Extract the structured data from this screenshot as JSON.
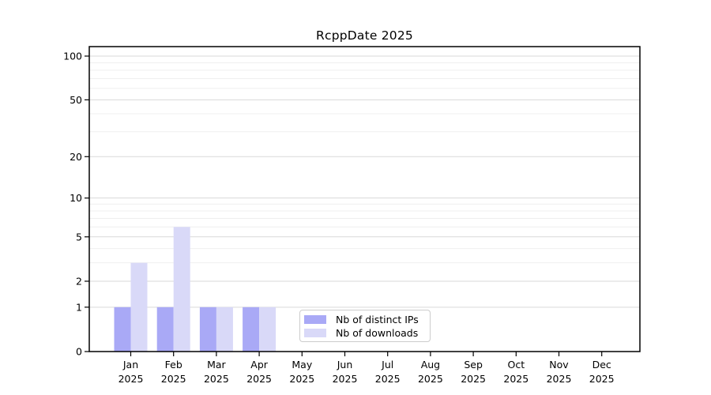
{
  "title": "RcppDate 2025",
  "chart_data": {
    "type": "bar",
    "title": "RcppDate 2025",
    "yscale": "log1p",
    "ylim": [
      0,
      100
    ],
    "y_major_ticks": [
      0,
      1,
      2,
      5,
      10,
      20,
      50,
      100
    ],
    "y_minor_gridlines": [
      3,
      4,
      6,
      7,
      8,
      9,
      30,
      40,
      60,
      70,
      80,
      90
    ],
    "grid": "horizontal",
    "months": [
      "Jan",
      "Feb",
      "Mar",
      "Apr",
      "May",
      "Jun",
      "Jul",
      "Aug",
      "Sep",
      "Oct",
      "Nov",
      "Dec"
    ],
    "year": "2025",
    "categories": [
      "Jan 2025",
      "Feb 2025",
      "Mar 2025",
      "Apr 2025",
      "May 2025",
      "Jun 2025",
      "Jul 2025",
      "Aug 2025",
      "Sep 2025",
      "Oct 2025",
      "Nov 2025",
      "Dec 2025"
    ],
    "series": [
      {
        "name": "Nb of distinct IPs",
        "color": "#a9a9f6",
        "values": [
          1,
          1,
          1,
          1,
          0,
          0,
          0,
          0,
          0,
          0,
          0,
          0
        ]
      },
      {
        "name": "Nb of downloads",
        "color": "#d9d9f8",
        "values": [
          3,
          6,
          1,
          1,
          0,
          0,
          0,
          0,
          0,
          0,
          0,
          0
        ]
      }
    ],
    "legend_position": "bottom-center"
  },
  "colors": {
    "bar_distinct_ips": "#a9a9f6",
    "bar_downloads": "#d9d9f8",
    "grid_major": "#d9d9d9",
    "grid_minor": "#efefef",
    "spine": "#000000",
    "text": "#000000",
    "legend_border": "#cccccc"
  }
}
